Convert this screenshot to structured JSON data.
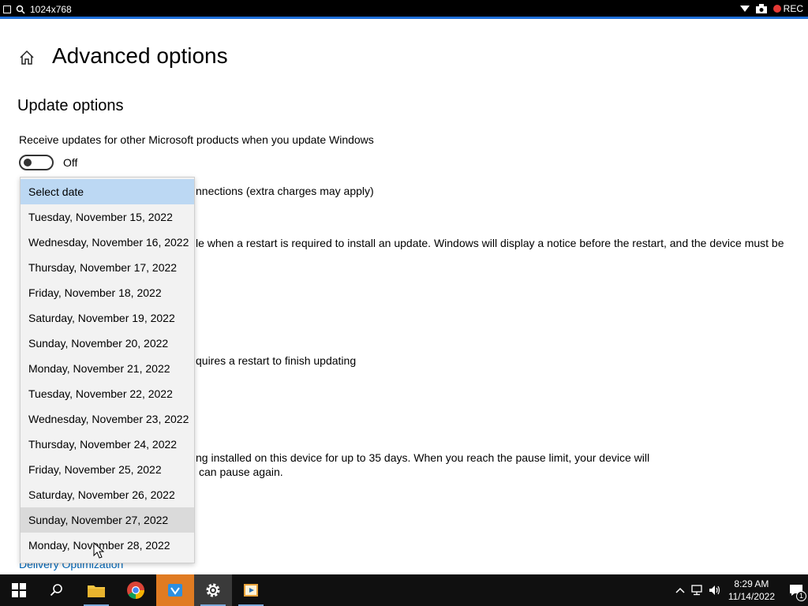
{
  "recorder": {
    "resolution": "1024x768",
    "rec_label": "REC"
  },
  "page": {
    "title": "Advanced options",
    "section_title": "Update options",
    "receive_updates_label": "Receive updates for other Microsoft products when you update Windows",
    "toggle_state": "Off",
    "partial_texts": [
      "nnections (extra charges may apply)",
      "le when a restart is required to install an update. Windows will display a notice before the restart, and the device must be",
      "quires a restart to finish updating",
      "ng installed on this device for up to 35 days. When you reach the pause limit, your device will",
      "can pause again."
    ],
    "delivery_link": "Delivery Optimization"
  },
  "dropdown": {
    "items": [
      "Select date",
      "Tuesday, November 15, 2022",
      "Wednesday, November 16, 2022",
      "Thursday, November 17, 2022",
      "Friday, November 18, 2022",
      "Saturday, November 19, 2022",
      "Sunday, November 20, 2022",
      "Monday, November 21, 2022",
      "Tuesday, November 22, 2022",
      "Wednesday, November 23, 2022",
      "Thursday, November 24, 2022",
      "Friday, November 25, 2022",
      "Saturday, November 26, 2022",
      "Sunday, November 27, 2022",
      "Monday, November 28, 2022"
    ],
    "selected_index": 0,
    "hover_index": 13
  },
  "taskbar": {
    "icons": [
      "windows-start-icon",
      "search-icon",
      "file-explorer-icon",
      "chrome-icon",
      "app-icon",
      "settings-icon",
      "media-app-icon"
    ],
    "time": "8:29 AM",
    "date": "11/14/2022",
    "notification_count": "1"
  },
  "colors": {
    "accent": "#1e6fd9",
    "selected_bg": "#bcd8f3",
    "link": "#0067b8",
    "rec": "#e53935"
  }
}
